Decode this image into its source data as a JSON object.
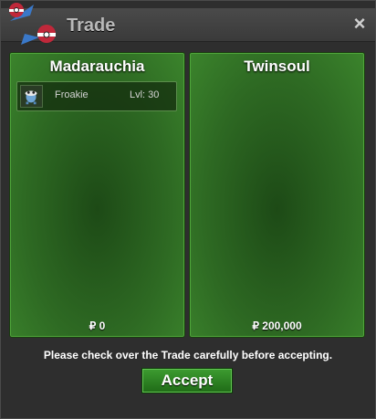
{
  "window": {
    "title": "Trade",
    "close_label": "×"
  },
  "left_panel": {
    "player_name": "Madarauchia",
    "items": [
      {
        "name": "Froakie",
        "level": "Lvl: 30",
        "icon": "froakie-sprite-icon"
      }
    ],
    "money": "₽ 0"
  },
  "right_panel": {
    "player_name": "Twinsoul",
    "items": [],
    "money": "₽ 200,000"
  },
  "notice": "Please check over the Trade carefully before accepting.",
  "accept_label": "Accept",
  "colors": {
    "panel_green": "#2e6a23",
    "button_green": "#3d9c31",
    "title_gray": "#b9b9b9"
  }
}
